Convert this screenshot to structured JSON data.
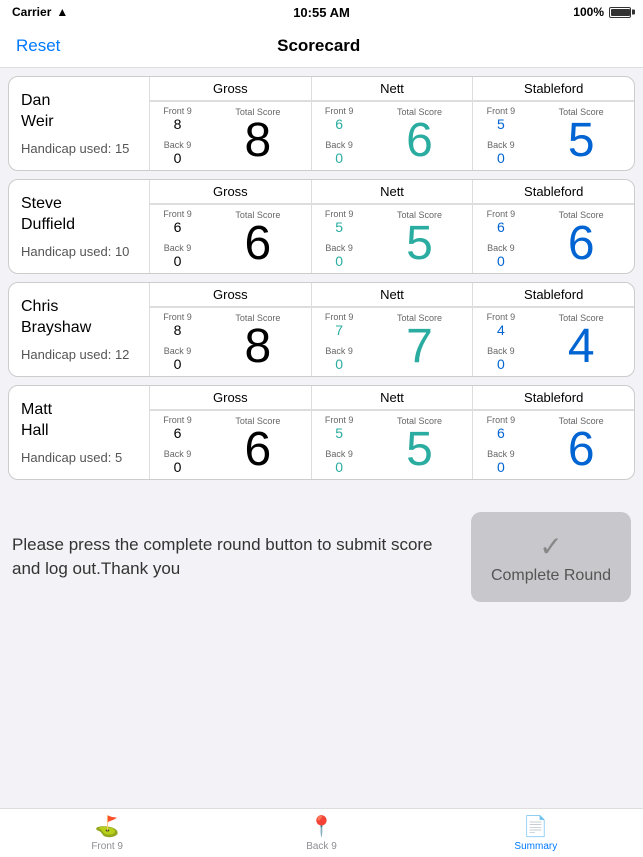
{
  "statusBar": {
    "carrier": "Carrier",
    "time": "10:55 AM",
    "battery": "100%"
  },
  "navBar": {
    "resetLabel": "Reset",
    "title": "Scorecard"
  },
  "players": [
    {
      "id": "player-1",
      "name": "Dan\nWeir",
      "handicap": "Handicap used: 15",
      "gross": {
        "front9Label": "Front 9",
        "front9": "8",
        "back9Label": "Back 9",
        "back9": "0",
        "totalLabel": "Total Score",
        "total": "8"
      },
      "nett": {
        "front9Label": "Front 9",
        "front9": "6",
        "back9Label": "Back 9",
        "back9": "0",
        "totalLabel": "Total Score",
        "total": "6"
      },
      "stableford": {
        "front9Label": "Front 9",
        "front9": "5",
        "back9Label": "Back 9",
        "back9": "0",
        "totalLabel": "Total Score",
        "total": "5"
      }
    },
    {
      "id": "player-2",
      "name": "Steve\nDuffield",
      "handicap": "Handicap used: 10",
      "gross": {
        "front9Label": "Front 9",
        "front9": "6",
        "back9Label": "Back 9",
        "back9": "0",
        "totalLabel": "Total Score",
        "total": "6"
      },
      "nett": {
        "front9Label": "Front 9",
        "front9": "5",
        "back9Label": "Back 9",
        "back9": "0",
        "totalLabel": "Total Score",
        "total": "5"
      },
      "stableford": {
        "front9Label": "Front 9",
        "front9": "6",
        "back9Label": "Back 9",
        "back9": "0",
        "totalLabel": "Total Score",
        "total": "6"
      }
    },
    {
      "id": "player-3",
      "name": "Chris\nBrayshaw",
      "handicap": "Handicap used: 12",
      "gross": {
        "front9Label": "Front 9",
        "front9": "8",
        "back9Label": "Back 9",
        "back9": "0",
        "totalLabel": "Total Score",
        "total": "8"
      },
      "nett": {
        "front9Label": "Front 9",
        "front9": "7",
        "back9Label": "Back 9",
        "back9": "0",
        "totalLabel": "Total Score",
        "total": "7"
      },
      "stableford": {
        "front9Label": "Front 9",
        "front9": "4",
        "back9Label": "Back 9",
        "back9": "0",
        "totalLabel": "Total Score",
        "total": "4"
      }
    },
    {
      "id": "player-4",
      "name": "Matt\nHall",
      "handicap": "Handicap used: 5",
      "gross": {
        "front9Label": "Front 9",
        "front9": "6",
        "back9Label": "Back 9",
        "back9": "0",
        "totalLabel": "Total Score",
        "total": "6"
      },
      "nett": {
        "front9Label": "Front 9",
        "front9": "5",
        "back9Label": "Back 9",
        "back9": "0",
        "totalLabel": "Total Score",
        "total": "5"
      },
      "stableford": {
        "front9Label": "Front 9",
        "front9": "6",
        "back9Label": "Back 9",
        "back9": "0",
        "totalLabel": "Total Score",
        "total": "6"
      }
    }
  ],
  "sectionHeaders": {
    "gross": "Gross",
    "nett": "Nett",
    "stableford": "Stableford"
  },
  "bottomText": "Please press the complete round button to submit score and log out.Thank you",
  "completeRound": {
    "checkIcon": "✓",
    "label": "Complete Round"
  },
  "tabs": [
    {
      "id": "front9",
      "label": "Front 9",
      "icon": "⛳",
      "active": false
    },
    {
      "id": "back9",
      "label": "Back 9",
      "icon": "📍",
      "active": false
    },
    {
      "id": "summary",
      "label": "Summary",
      "icon": "📄",
      "active": true
    }
  ]
}
